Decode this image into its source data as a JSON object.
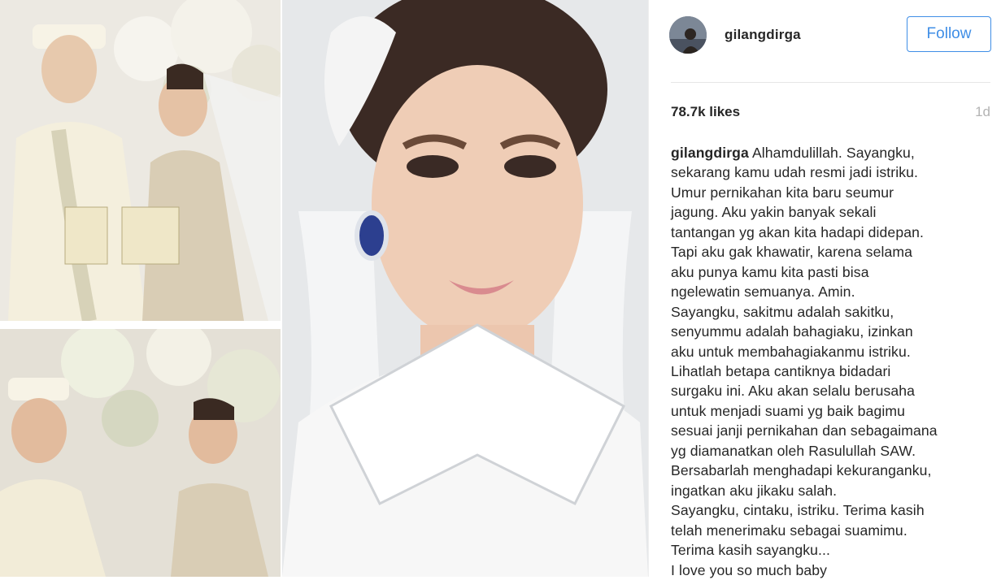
{
  "post": {
    "username": "gilangdirga",
    "follow_label": "Follow",
    "likes": "78.7k likes",
    "time": "1d",
    "caption_lines": [
      "Alhamdulillah. Sayangku,",
      "sekarang kamu udah resmi jadi istriku.",
      "Umur pernikahan kita baru seumur",
      "jagung. Aku yakin banyak sekali",
      "tantangan yg akan kita hadapi didepan.",
      "Tapi aku gak khawatir, karena selama",
      "aku punya kamu kita pasti bisa",
      "ngelewatin semuanya. Amin.",
      "Sayangku, sakitmu adalah sakitku,",
      "senyummu adalah bahagiaku, izinkan",
      "aku untuk membahagiakanmu istriku.",
      "Lihatlah betapa cantiknya bidadari",
      "surgaku ini. Aku akan selalu berusaha",
      "untuk menjadi suami yg baik bagimu",
      "sesuai janji pernikahan dan sebagaimana",
      "yg diamanatkan oleh Rasulullah SAW.",
      "Bersabarlah menghadapi kekuranganku,",
      "ingatkan aku jikaku salah.",
      "Sayangku, cintaku, istriku. Terima kasih",
      "telah menerimaku sebagai suamimu.",
      "Terima kasih sayangku...",
      "I love you so much baby"
    ]
  },
  "colors": {
    "follow_blue": "#3f8ee6",
    "text": "#262626",
    "muted": "#b3b3b3"
  }
}
